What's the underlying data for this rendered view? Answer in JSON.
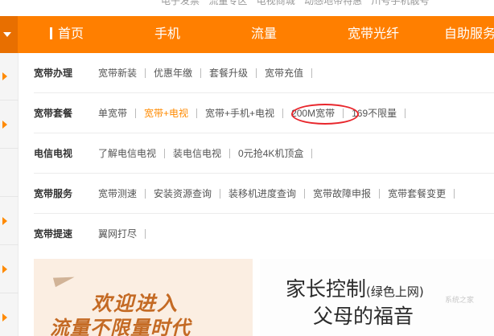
{
  "top_links": [
    "电子发票",
    "流量专区",
    "电视商城",
    "动感地带特惠",
    "川号手机靓号"
  ],
  "nav": {
    "items": [
      "首页",
      "手机",
      "流量",
      "宽带光纤",
      "自助服务"
    ],
    "accent": "#ff7f00"
  },
  "menu": {
    "rows": [
      {
        "title": "宽带办理",
        "links": [
          "宽带新装",
          "优惠年缴",
          "套餐升级",
          "宽带充值"
        ]
      },
      {
        "title": "宽带套餐",
        "links": [
          "单宽带",
          "宽带+电视",
          "宽带+手机+电视",
          "200M宽带",
          "169不限量"
        ]
      },
      {
        "title": "电信电视",
        "links": [
          "了解电信电视",
          "装电信电视",
          "0元抢4K机顶盒"
        ]
      },
      {
        "title": "宽带服务",
        "links": [
          "宽带测速",
          "安装资源查询",
          "装移机进度查询",
          "宽带故障申报",
          "宽带套餐变更"
        ]
      },
      {
        "title": "宽带提速",
        "links": [
          "翼网打尽"
        ]
      }
    ],
    "highlight_color": "#ff8a00",
    "circle_color": "#e8262c"
  },
  "banners": {
    "left": {
      "line1": "欢迎进入",
      "line2": "流量不限量时代"
    },
    "right": {
      "line1": "家长控制",
      "line1_small": "(绿色上网)",
      "line2": "父母的福音"
    },
    "watermark": "系统之家"
  }
}
